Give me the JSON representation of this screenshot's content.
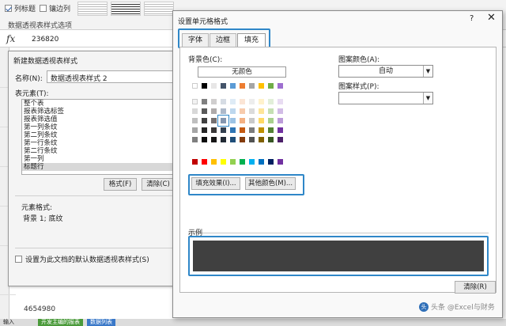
{
  "ribbon": {
    "checkbox_row_headers": "列标题",
    "checkbox_banded_cols": "镶边列",
    "caption": "数据透视表样式选项"
  },
  "formula_bar": {
    "fx": "fx",
    "value": "236820"
  },
  "sheet": {
    "bottom_value": "4654980",
    "tab_labels": [
      "输入",
      "开发主编的报表",
      "数据列表"
    ]
  },
  "style_dialog": {
    "title": "新建数据透视表样式",
    "name_label": "名称(N):",
    "name_value": "数据透视表样式 2",
    "elements_label": "表元素(T):",
    "elements": [
      "整个表",
      "报表筛选标签",
      "报表筛选值",
      "第一列条纹",
      "第二列条纹",
      "第一行条纹",
      "第二行条纹",
      "第一列",
      "标题行"
    ],
    "selected_element": "标题行",
    "format_button": "格式(F)",
    "clear_button": "清除(C)",
    "element_format_label": "元素格式:",
    "element_format_value": "背景 1; 底纹",
    "default_checkbox": "设置为此文档的默认数据透视表样式(S)"
  },
  "format_dialog": {
    "title": "设置单元格格式",
    "help": "?",
    "close": "✕",
    "tabs": [
      "字体",
      "边框",
      "填充"
    ],
    "active_tab": "填充",
    "background_color_label": "背景色(C):",
    "no_color_button": "无颜色",
    "pattern_color_label": "图案颜色(A):",
    "pattern_color_value": "自动",
    "pattern_style_label": "图案样式(P):",
    "pattern_style_value": "",
    "fill_effects_button": "填充效果(I)...",
    "more_colors_button": "其他颜色(M)...",
    "sample_label": "示例",
    "sample_color": "#404040",
    "clear_button": "清除(R)",
    "accent_color": "#2f87c8"
  },
  "watermark": {
    "text": "头条 @Excel与财务"
  }
}
